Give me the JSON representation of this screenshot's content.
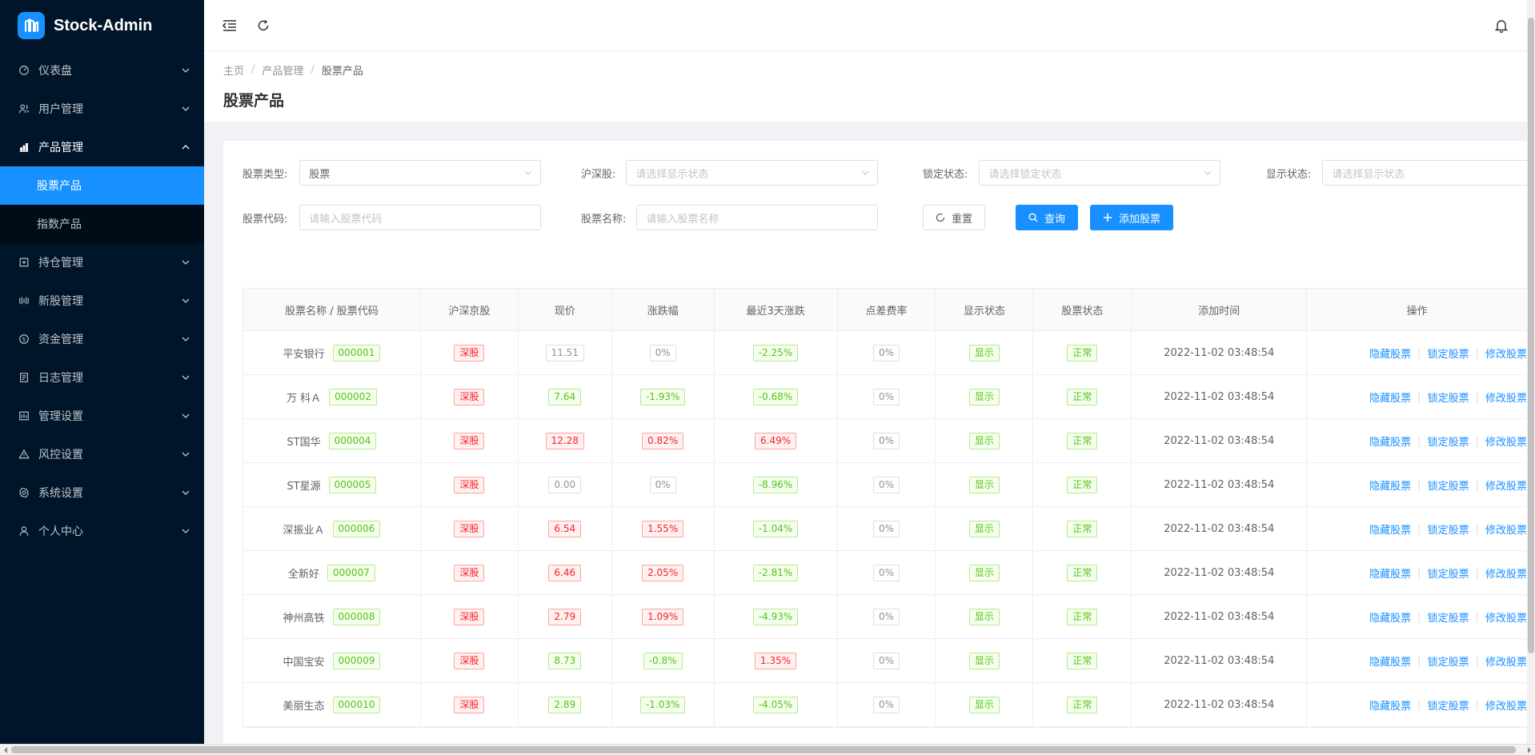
{
  "app": {
    "title": "Stock-Admin"
  },
  "sidebar": {
    "items": [
      {
        "label": "仪表盘",
        "icon": "dashboard-icon"
      },
      {
        "label": "用户管理",
        "icon": "users-icon"
      },
      {
        "label": "产品管理",
        "icon": "chart-icon",
        "open": true,
        "children": [
          {
            "label": "股票产品",
            "active": true
          },
          {
            "label": "指数产品"
          }
        ]
      },
      {
        "label": "持仓管理",
        "icon": "position-icon"
      },
      {
        "label": "新股管理",
        "icon": "ipo-icon"
      },
      {
        "label": "资金管理",
        "icon": "money-icon"
      },
      {
        "label": "日志管理",
        "icon": "log-icon"
      },
      {
        "label": "管理设置",
        "icon": "admin-settings-icon"
      },
      {
        "label": "风控设置",
        "icon": "warning-icon"
      },
      {
        "label": "系统设置",
        "icon": "gear-icon"
      },
      {
        "label": "个人中心",
        "icon": "user-icon"
      }
    ]
  },
  "breadcrumb": [
    "主页",
    "产品管理",
    "股票产品"
  ],
  "page_title": "股票产品",
  "filters": {
    "stock_type": {
      "label": "股票类型:",
      "value": "股票"
    },
    "exchange": {
      "label": "沪深股:",
      "placeholder": "请选择显示状态"
    },
    "lock_status": {
      "label": "锁定状态:",
      "placeholder": "请选择锁定状态"
    },
    "show_status": {
      "label": "显示状态:",
      "placeholder": "请选择显示状态"
    },
    "code": {
      "label": "股票代码:",
      "placeholder": "请输入股票代码"
    },
    "name": {
      "label": "股票名称:",
      "placeholder": "请输入股票名称"
    }
  },
  "buttons": {
    "reset": "重置",
    "search": "查询",
    "add": "添加股票"
  },
  "table": {
    "columns": [
      "股票名称 / 股票代码",
      "沪深京股",
      "现价",
      "涨跌幅",
      "最近3天涨跌",
      "点差费率",
      "显示状态",
      "股票状态",
      "添加时间",
      "操作"
    ],
    "ops": [
      "隐藏股票",
      "锁定股票",
      "修改股票"
    ],
    "rows": [
      {
        "name": "平安银行",
        "code": "000001",
        "market": "深股",
        "price": "11.51",
        "price_c": "gray",
        "chg": "0%",
        "chg_c": "gray",
        "chg3": "-2.25%",
        "chg3_c": "green",
        "spread": "0%",
        "show": "显示",
        "status": "正常",
        "time": "2022-11-02 03:48:54"
      },
      {
        "name": "万 科Ａ",
        "code": "000002",
        "market": "深股",
        "price": "7.64",
        "price_c": "green",
        "chg": "-1.93%",
        "chg_c": "green",
        "chg3": "-0.68%",
        "chg3_c": "green",
        "spread": "0%",
        "show": "显示",
        "status": "正常",
        "time": "2022-11-02 03:48:54"
      },
      {
        "name": "ST国华",
        "code": "000004",
        "market": "深股",
        "price": "12.28",
        "price_c": "red",
        "chg": "0.82%",
        "chg_c": "red",
        "chg3": "6.49%",
        "chg3_c": "red",
        "spread": "0%",
        "show": "显示",
        "status": "正常",
        "time": "2022-11-02 03:48:54"
      },
      {
        "name": "ST星源",
        "code": "000005",
        "market": "深股",
        "price": "0.00",
        "price_c": "gray",
        "chg": "0%",
        "chg_c": "gray",
        "chg3": "-8.96%",
        "chg3_c": "green",
        "spread": "0%",
        "show": "显示",
        "status": "正常",
        "time": "2022-11-02 03:48:54"
      },
      {
        "name": "深振业Ａ",
        "code": "000006",
        "market": "深股",
        "price": "6.54",
        "price_c": "red",
        "chg": "1.55%",
        "chg_c": "red",
        "chg3": "-1.04%",
        "chg3_c": "green",
        "spread": "0%",
        "show": "显示",
        "status": "正常",
        "time": "2022-11-02 03:48:54"
      },
      {
        "name": "全新好",
        "code": "000007",
        "market": "深股",
        "price": "6.46",
        "price_c": "red",
        "chg": "2.05%",
        "chg_c": "red",
        "chg3": "-2.81%",
        "chg3_c": "green",
        "spread": "0%",
        "show": "显示",
        "status": "正常",
        "time": "2022-11-02 03:48:54"
      },
      {
        "name": "神州高铁",
        "code": "000008",
        "market": "深股",
        "price": "2.79",
        "price_c": "red",
        "chg": "1.09%",
        "chg_c": "red",
        "chg3": "-4.93%",
        "chg3_c": "green",
        "spread": "0%",
        "show": "显示",
        "status": "正常",
        "time": "2022-11-02 03:48:54"
      },
      {
        "name": "中国宝安",
        "code": "000009",
        "market": "深股",
        "price": "8.73",
        "price_c": "green",
        "chg": "-0.8%",
        "chg_c": "green",
        "chg3": "1.35%",
        "chg3_c": "red",
        "spread": "0%",
        "show": "显示",
        "status": "正常",
        "time": "2022-11-02 03:48:54"
      },
      {
        "name": "美丽生态",
        "code": "000010",
        "market": "深股",
        "price": "2.89",
        "price_c": "green",
        "chg": "-1.03%",
        "chg_c": "green",
        "chg3": "-4.05%",
        "chg3_c": "green",
        "spread": "0%",
        "show": "显示",
        "status": "正常",
        "time": "2022-11-02 03:48:54"
      }
    ]
  },
  "colors": {
    "primary": "#1890ff",
    "sidebar_bg": "#001529",
    "up": "#f5222d",
    "down": "#52c41a"
  }
}
